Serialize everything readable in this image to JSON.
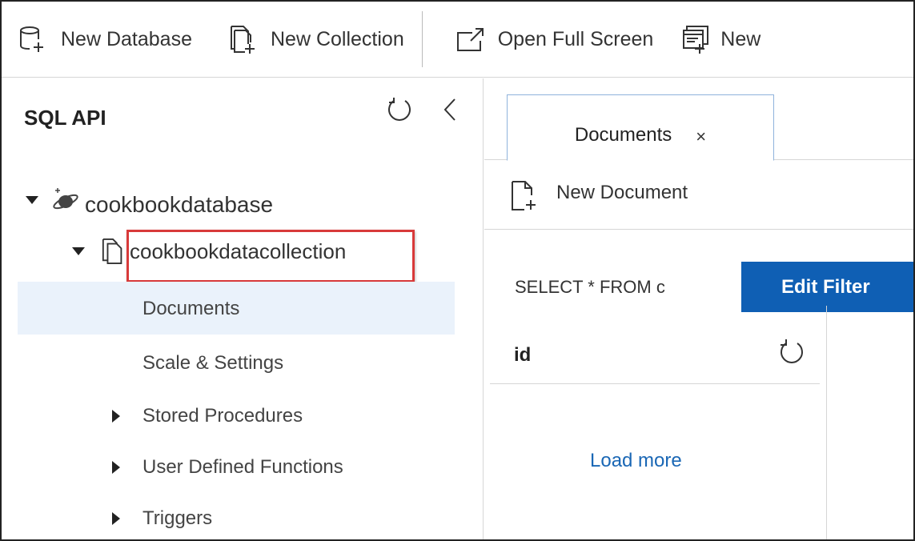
{
  "toolbar": {
    "new_database": "New Database",
    "new_collection": "New Collection",
    "open_full_screen": "Open Full Screen",
    "new_truncated": "New"
  },
  "sidebar": {
    "title": "SQL API",
    "database": "cookbookdatabase",
    "collection": "cookbookdatacollection",
    "items": [
      {
        "label": "Documents"
      },
      {
        "label": "Scale & Settings"
      },
      {
        "label": "Stored Procedures"
      },
      {
        "label": "User Defined Functions"
      },
      {
        "label": "Triggers"
      }
    ]
  },
  "main": {
    "tab_label": "Documents",
    "tab_close": "×",
    "new_document": "New Document",
    "query": "SELECT * FROM c",
    "edit_filter": "Edit Filter",
    "column_id": "id",
    "load_more": "Load more"
  },
  "colors": {
    "accent": "#0f5fb4",
    "link": "#1a67b5",
    "selected_bg": "#eaf2fb",
    "highlight": "#d83a3a"
  }
}
